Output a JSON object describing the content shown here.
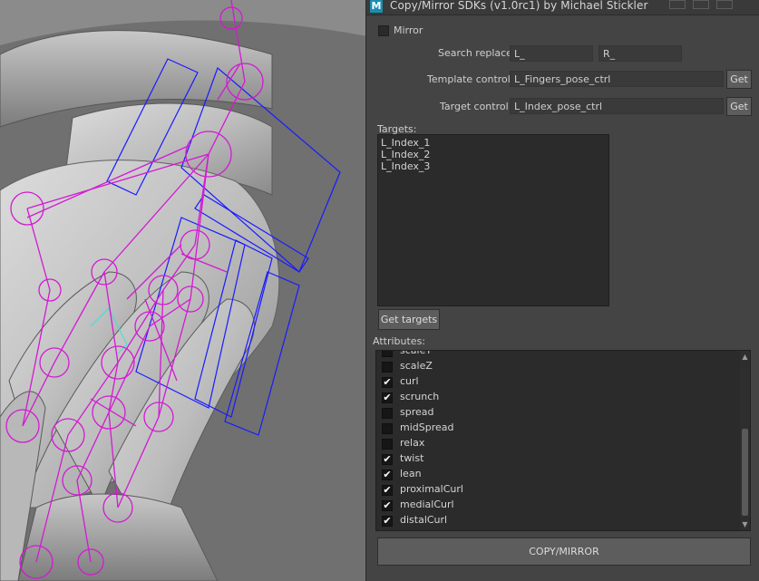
{
  "window": {
    "title": "Copy/Mirror SDKs (v1.0rc1) by Michael Stickler",
    "app_icon": "M"
  },
  "mirror": {
    "label": "Mirror",
    "checked": false
  },
  "search_replace": {
    "label": "Search replace",
    "search_value": "L_",
    "replace_value": "R_"
  },
  "template_control": {
    "label": "Template control",
    "value": "L_Fingers_pose_ctrl",
    "button": "Get"
  },
  "target_control": {
    "label": "Target control",
    "value": "L_Index_pose_ctrl",
    "button": "Get"
  },
  "targets": {
    "label": "Targets:",
    "items": [
      "L_Index_1",
      "L_Index_2",
      "L_Index_3"
    ],
    "get_button": "Get targets"
  },
  "attributes": {
    "label": "Attributes:",
    "items": [
      {
        "name": "scaleY",
        "checked": false
      },
      {
        "name": "scaleZ",
        "checked": false
      },
      {
        "name": "curl",
        "checked": true
      },
      {
        "name": "scrunch",
        "checked": true
      },
      {
        "name": "spread",
        "checked": false
      },
      {
        "name": "midSpread",
        "checked": false
      },
      {
        "name": "relax",
        "checked": false
      },
      {
        "name": "twist",
        "checked": true
      },
      {
        "name": "lean",
        "checked": true
      },
      {
        "name": "proximalCurl",
        "checked": true
      },
      {
        "name": "medialCurl",
        "checked": true
      },
      {
        "name": "distalCurl",
        "checked": true
      }
    ]
  },
  "copy_mirror_button": "COPY/MIRROR",
  "colors": {
    "joint_magenta": "#d21ad2",
    "control_blue": "#1a1aff",
    "panel_bg": "#444444",
    "field_bg": "#2b2b2b"
  }
}
